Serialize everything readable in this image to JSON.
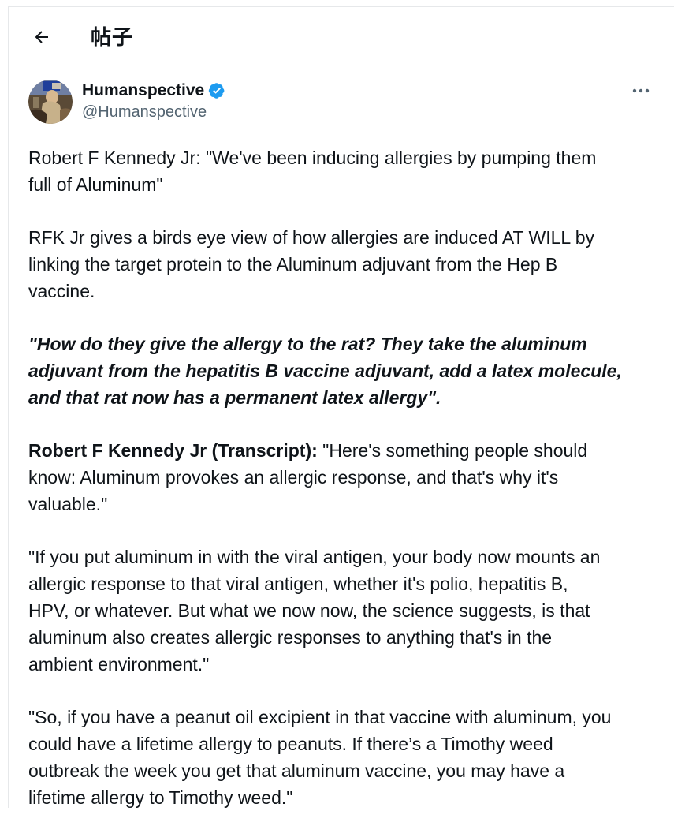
{
  "header": {
    "back_icon": "arrow-left-icon",
    "title": "帖子"
  },
  "author": {
    "display_name": "Humanspective",
    "handle": "@Humanspective",
    "verified_icon": "verified-badge-icon",
    "verified_color": "#1d9bf0",
    "more_icon": "more-horizontal-icon"
  },
  "tweet": {
    "p1": "Robert F Kennedy Jr: \"We've been inducing allergies by pumping them\nfull of Aluminum\"",
    "p2": "RFK Jr gives a birds eye view of how allergies are induced AT WILL by\nlinking the target protein to the Aluminum adjuvant from the Hep B\nvaccine.",
    "p3": "\"How do they give the allergy to the rat? They take the aluminum\nadjuvant from the hepatitis B vaccine adjuvant, add a latex molecule,\nand that rat now has a permanent latex allergy\".",
    "p4_speaker": "Robert F Kennedy Jr (Transcript):",
    "p4_text": " \"Here's something people should\nknow: Aluminum provokes an allergic response, and that's why it's\nvaluable.\"",
    "p5": "\"If you put aluminum in with the viral antigen, your body now  mounts an\nallergic response to that viral antigen, whether it's polio, hepatitis B,\nHPV, or whatever. But what we now now, the science suggests, is that\naluminum also creates allergic responses to anything that's in the\nambient environment.\"",
    "p6": "\"So, if you have a peanut oil excipient in that vaccine with aluminum, you\ncould have a lifetime allergy to peanuts. If there’s a Timothy weed\noutbreak the week you get that aluminum vaccine, you may have a\nlifetime allergy to Timothy weed.\""
  }
}
